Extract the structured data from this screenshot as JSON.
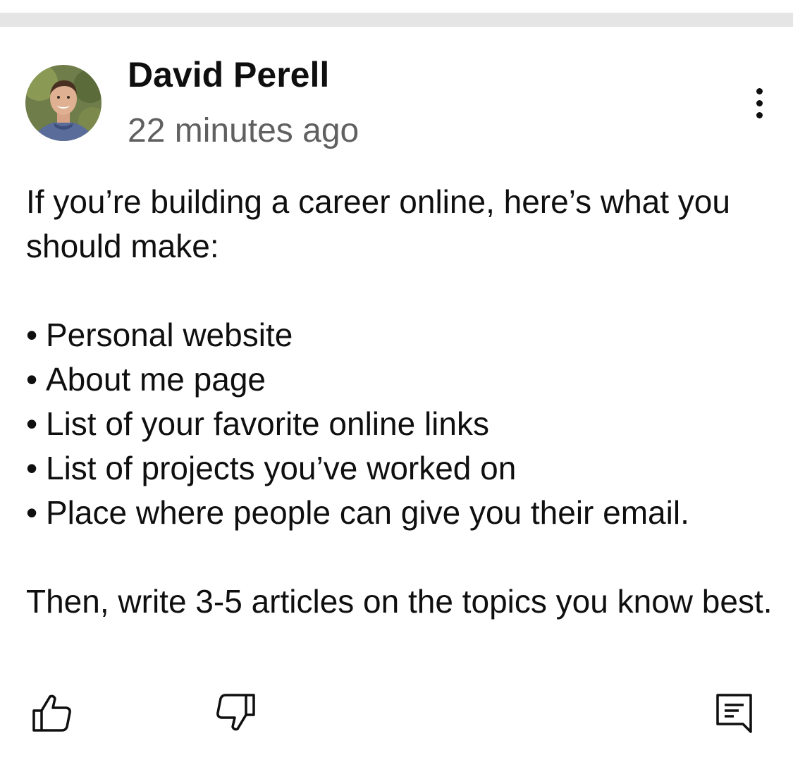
{
  "post": {
    "author": "David Perell",
    "timestamp": "22 minutes ago",
    "intro": "If you’re building a career online, here’s what you should make:",
    "bullets": [
      "Personal website",
      "About me page",
      "List of your favorite online links",
      "List of projects you’ve worked on",
      "Place where people can give you their email."
    ],
    "bullet_symbol": "•",
    "closing": "Then, write 3-5 articles on the topics you know best."
  },
  "icons": {
    "menu": "more-vertical-icon",
    "like": "thumbs-up-icon",
    "dislike": "thumbs-down-icon",
    "comment": "comment-icon"
  },
  "colors": {
    "text": "#0f0f0f",
    "secondary_text": "#606060",
    "divider": "#e5e5e5"
  }
}
